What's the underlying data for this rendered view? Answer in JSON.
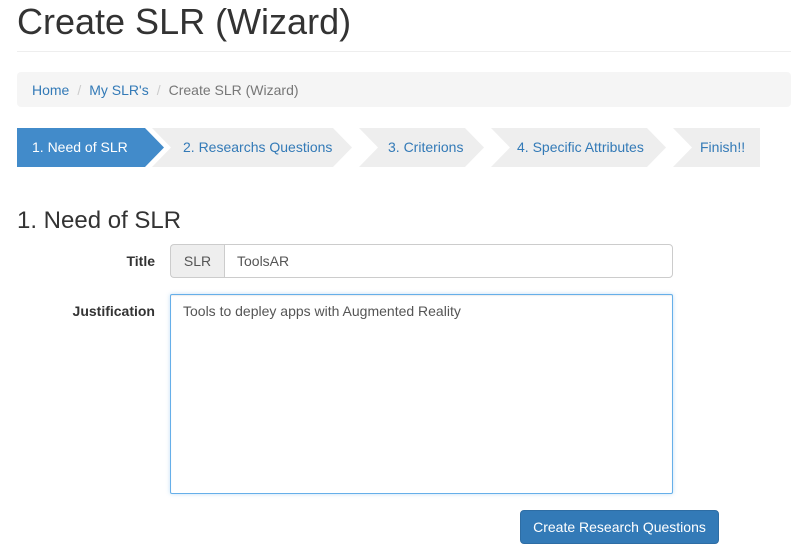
{
  "page": {
    "title": "Create SLR (Wizard)"
  },
  "breadcrumb": {
    "items": [
      {
        "label": "Home"
      },
      {
        "label": "My SLR's"
      },
      {
        "label": "Create SLR (Wizard)"
      }
    ],
    "separator": "/"
  },
  "wizard": {
    "steps": [
      {
        "label": "1. Need of SLR",
        "active": true
      },
      {
        "label": "2. Researchs Questions",
        "active": false
      },
      {
        "label": "3. Criterions",
        "active": false
      },
      {
        "label": "4. Specific Attributes",
        "active": false
      },
      {
        "label": "Finish!!",
        "active": false
      }
    ],
    "active_color": "#428bca",
    "inactive_color": "#eeeeee"
  },
  "form": {
    "heading": "1. Need of SLR",
    "title_label": "Title",
    "title_addon": "SLR",
    "title_value": "ToolsAR",
    "justification_label": "Justification",
    "justification_value": "Tools to depley apps with Augmented Reality",
    "submit_label": "Create Research Questions"
  }
}
